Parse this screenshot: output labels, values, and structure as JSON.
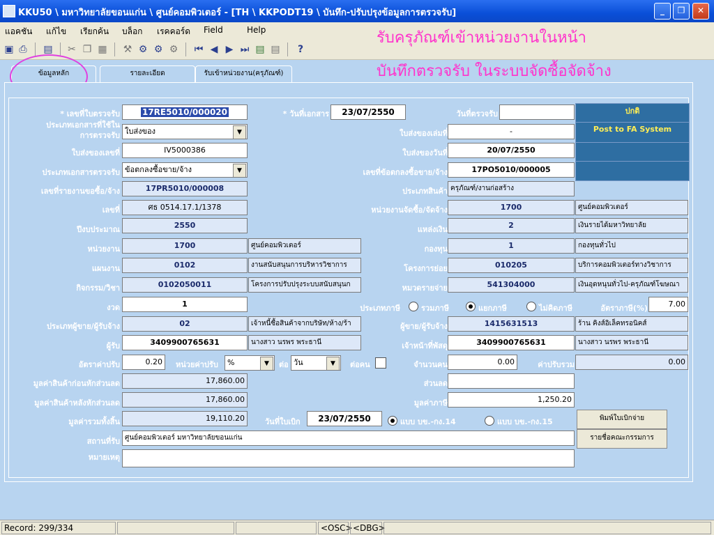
{
  "window": {
    "title": "KKU50 \\ มหาวิทยาลัยขอนแก่น \\ ศูนย์คอมพิวเตอร์ - [TH \\ KKPODT19 \\ บันทึก-ปรับปรุงข้อมูลการตรวจรับ]"
  },
  "menu": [
    "แอคชัน",
    "แก้ไข",
    "เรียกค้น",
    "บล็อก",
    "เรคคอร์ด",
    "Field",
    "Help"
  ],
  "annotation": {
    "line1": "รับครุภัณฑ์เข้าหน่วยงานในหน้า",
    "line2": "บันทึกตรวจรับ ในระบบจัดซื้อจัดจ้าง"
  },
  "tabs": [
    "ข้อมูลหลัก",
    "รายละเอียด",
    "รับเข้าหน่วยงาน(ครุภัณฑ์)"
  ],
  "labels": {
    "receipt_no": "* เลขที่ใบตรวจรับ",
    "doc_date": "* วันที่เอกสาร",
    "inspect_date": "วันที่ตรวจรับ",
    "doc_type_1": "ประเภทเอกสารที่ใช้ใน",
    "doc_type_2": "การตรวจรับ",
    "delivery_book_no": "ใบส่งของเล่มที่",
    "delivery_no": "ใบส่งของเลขที่",
    "delivery_date": "ใบส่งของวันที่",
    "inspect_doc_type": "ประเภทเอกสารตรวจรับ",
    "agreement_no": "เลขที่ข้อตกลงซื้อขาย/จ้าง",
    "request_no": "เลขที่รายงานขอซื้อ/จ้าง",
    "product_type": "ประเภทสินค้า",
    "no": "เลขที่",
    "purchase_unit": "หน่วยงานจัดซื้อ/จัดจ้าง",
    "budget_year": "ปีงบประมาณ",
    "fund_source": "แหล่งเงิน",
    "unit": "หน่วยงาน",
    "fund": "กองทุน",
    "plan": "แผนงาน",
    "sub_project": "โครงการย่อย",
    "activity": "กิจกรรม/วิชา",
    "expense_cat": "หมวดรายจ่าย",
    "installment": "งวด",
    "tax_type": "ประเภทภาษี",
    "tax_incl": "รวมภาษี",
    "tax_sep": "แยกภาษี",
    "tax_none": "ไม่คิดภาษี",
    "tax_rate": "อัตราภาษี(%)",
    "vendor_type": "ประเภทผู้ขาย/ผู้รับจ้าง",
    "vendor": "ผู้ขาย/ผู้รับจ้าง",
    "receiver": "ผู้รับ",
    "supply_officer": "เจ้าหน้าที่พัสดุ",
    "fine_rate": "อัตราค่าปรับ",
    "fine_unit": "หน่วยค่าปรับ",
    "per": "ต่อ",
    "per_person": "ต่อคน",
    "amount": "จำนวนคน",
    "total_fine": "ค่าปรับรวม",
    "value_before": "มูลค่าสินค้าก่อนหักส่วนลด",
    "discount": "ส่วนลด",
    "value_after": "มูลค่าสินค้าหลังหักส่วนลด",
    "tax_value": "มูลค่าภาษี",
    "total": "มูลค่ารวมทั้งสิ้น",
    "withdraw_date": "วันที่ใบเบิก",
    "form1": "แบบ บข.-กง.14",
    "form2": "แบบ บข.-กง.15",
    "place": "สถานที่รับ",
    "note": "หมายเหตุ"
  },
  "values": {
    "receipt_no": "17RE5010/000020",
    "doc_date": "23/07/2550",
    "inspect_date": "",
    "status": "ปกติ",
    "post_status": "Post to FA System",
    "doc_type": "ใบส่งของ",
    "delivery_book_no": "-",
    "delivery_no": "IV5000386",
    "delivery_date": "20/07/2550",
    "inspect_doc_type": "ข้อตกลงซื้อขาย/จ้าง",
    "agreement_no": "17PO5010/000005",
    "request_no": "17PR5010/000008",
    "product_type": "ครุภัณฑ์/งานก่อสร้าง",
    "no": "ศธ 0514.17.1/1378",
    "purchase_unit_code": "1700",
    "purchase_unit_name": "ศูนย์คอมพิวเตอร์",
    "budget_year": "2550",
    "fund_source_code": "2",
    "fund_source_name": "เงินรายได้มหาวิทยาลัย",
    "unit_code": "1700",
    "unit_name": "ศูนย์คอมพิวเตอร์",
    "fund_code": "1",
    "fund_name": "กองทุนทั่วไป",
    "plan_code": "0102",
    "plan_name": "งานสนับสนุนการบริหารวิชาการ",
    "sub_project_code": "010205",
    "sub_project_name": "บริการคอมพิวเตอร์ทางวิชาการ",
    "activity_code": "0102050011",
    "activity_name": "โครงการปรับปรุงระบบสนับสนุนก",
    "expense_code": "541304000",
    "expense_name": "เงินอุดหนุนทั่วไป-ครุภัณฑ์โฆษณา",
    "installment": "1",
    "tax_rate": "7.00",
    "vendor_type_code": "02",
    "vendor_type_name": "เจ้าหนี้ซื้อสินค้าจากบริษัท/ห้าง/ร้า",
    "vendor_code": "1415631513",
    "vendor_name": "ร้าน คิงส์อิเล็คทรอนิคส์",
    "receiver_id": "3409900765631",
    "receiver_name": "นางสาว นรพร  พระธานี",
    "officer_id": "3409900765631",
    "officer_name": "นางสาว นรพร  พระธานี",
    "fine_rate": "0.20",
    "fine_unit": "%",
    "per": "วัน",
    "amount": "0.00",
    "total_fine": "0.00",
    "value_before": "17,860.00",
    "discount": "",
    "value_after": "17,860.00",
    "tax_value": "1,250.20",
    "total": "19,110.20",
    "withdraw_date": "23/07/2550",
    "place": "ศูนย์คอมพิวเตอร์ มหาวิทยาลัยขอนแก่น",
    "note": ""
  },
  "buttons": {
    "print": "พิมพ์ใบเบิกจ่าย",
    "committee": "รายชื่อคณะกรรมการ"
  },
  "status": {
    "record": "Record: 299/334",
    "osc": "<OSC>",
    "dbg": "<DBG>"
  }
}
